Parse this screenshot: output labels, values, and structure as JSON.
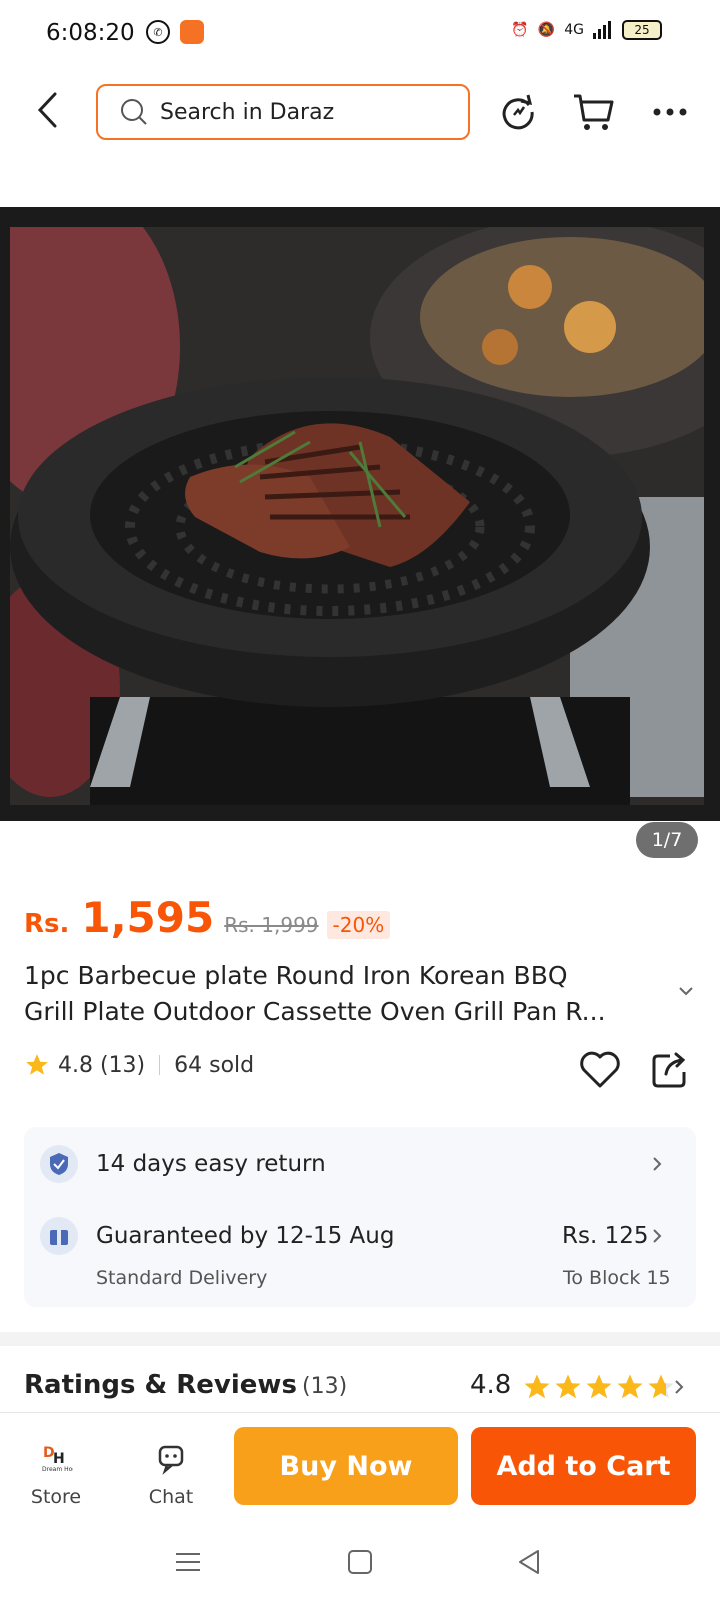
{
  "status_bar": {
    "time": "6:08:20",
    "network": "4G",
    "battery": "25"
  },
  "header": {
    "search_placeholder": "Search in Daraz"
  },
  "gallery": {
    "counter": "1/7"
  },
  "product": {
    "currency": "Rs.",
    "price": "1,595",
    "old_price": "Rs. 1,999",
    "discount": "-20%",
    "title_line1": "1pc Barbecue plate Round Iron Korean BBQ",
    "title_line2": "Grill Plate Outdoor Cassette Oven Grill Pan R...",
    "rating": "4.8 (13)",
    "sold": "64 sold"
  },
  "service": {
    "return_text": "14 days easy return",
    "delivery_text": "Guaranteed by 12-15 Aug",
    "delivery_type": "Standard Delivery",
    "delivery_fee": "Rs. 125",
    "delivery_location": "To Block 15"
  },
  "reviews": {
    "title": "Ratings & Reviews",
    "count": "(13)",
    "score": "4.8"
  },
  "bottom_bar": {
    "store_label": "Store",
    "chat_label": "Chat",
    "buy_now": "Buy Now",
    "add_to_cart": "Add to Cart",
    "store_logo_text": "Dream Hocker"
  },
  "colors": {
    "accent": "#f85606",
    "buy": "#f9a01b",
    "star": "#fbb81b"
  }
}
